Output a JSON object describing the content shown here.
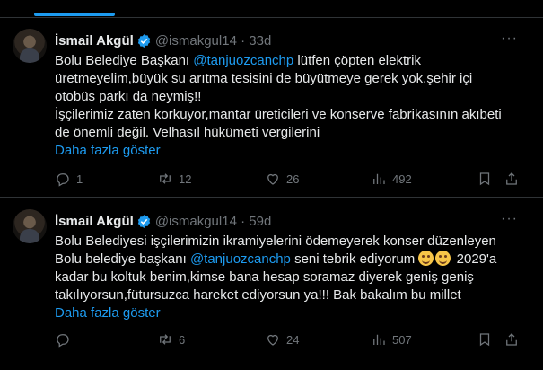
{
  "tweets": [
    {
      "name": "İsmail Akgül",
      "handle": "@ismakgul14",
      "time": "33d",
      "lines": [
        {
          "pre": "Bolu Belediye Başkanı ",
          "mention": "@tanjuozcanchp",
          "post": " lütfen çöpten elektrik"
        },
        {
          "text": "üretmeyelim,büyük su arıtma tesisini de büyütmeye gerek yok,şehir içi"
        },
        {
          "text": "otobüs parkı da neymiş!!"
        },
        {
          "text": "İşçilerimiz zaten korkuyor,mantar üreticileri ve konserve fabrikasının akıbeti"
        },
        {
          "text": "de önemli değil. Velhasıl hükümeti vergilerini"
        }
      ],
      "show_more": "Daha fazla göster",
      "stats": {
        "replies": "1",
        "reposts": "12",
        "likes": "26",
        "views": "492"
      }
    },
    {
      "name": "İsmail Akgül",
      "handle": "@ismakgul14",
      "time": "59d",
      "lines": [
        {
          "text": "Bolu Belediyesi işçilerimizin ikramiyelerini ödemeyerek konser düzenleyen"
        },
        {
          "pre": "Bolu belediye başkanı ",
          "mention": "@tanjuozcanchp",
          "post": " seni tebrik ediyorum ",
          "post2": " 2029'a"
        },
        {
          "text": "kadar bu koltuk benim,kimse bana hesap soramaz diyerek geniş geniş"
        },
        {
          "text": "takılıyorsun,fütursuzca hareket ediyorsun ya!!! Bak bakalım bu millet"
        }
      ],
      "show_more": "Daha fazla göster",
      "stats": {
        "replies": "",
        "reposts": "6",
        "likes": "24",
        "views": "507"
      }
    }
  ],
  "icons": {
    "verified": "verified-badge-icon",
    "more": "more-options-icon",
    "reply": "reply-icon",
    "repost": "repost-icon",
    "like": "like-icon",
    "views": "views-icon",
    "bookmark": "bookmark-icon",
    "share": "share-icon",
    "emoji": "smiling-face-emoji"
  },
  "colors": {
    "accent": "#1d9bf0",
    "background": "#000000",
    "muted": "#71767b",
    "text": "#e7e9ea"
  }
}
